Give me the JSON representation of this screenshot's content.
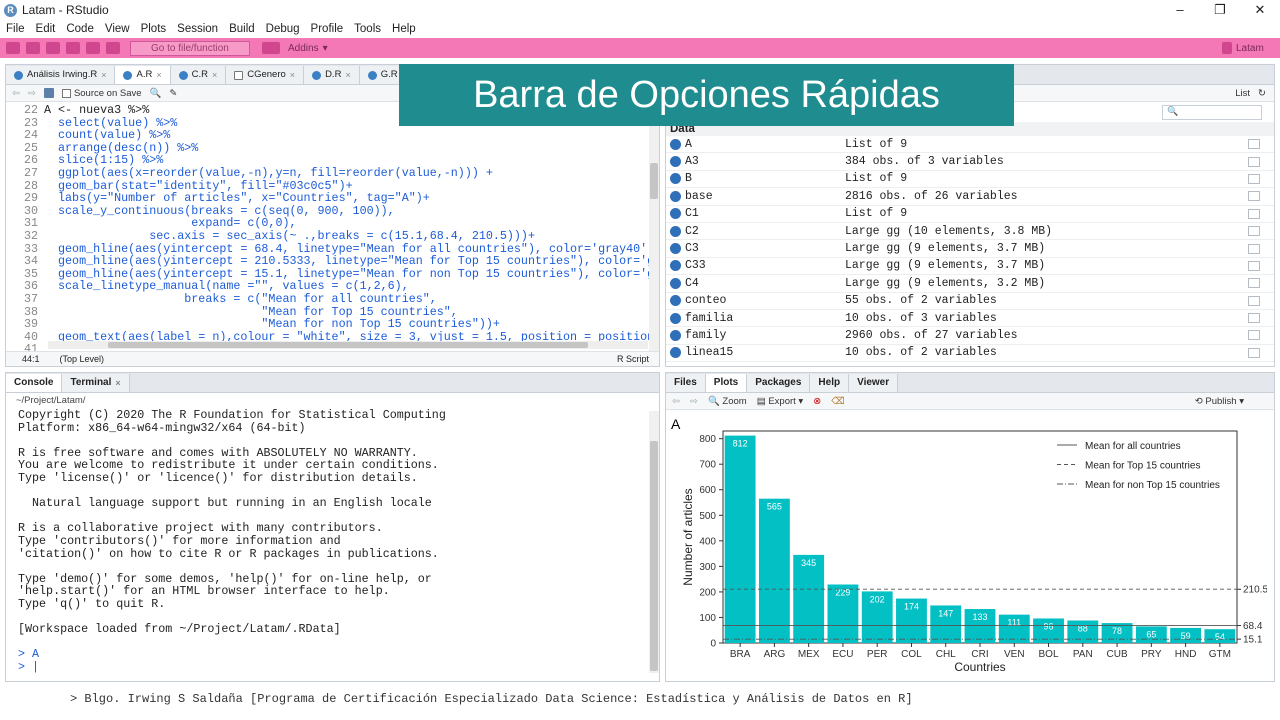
{
  "window": {
    "title": "Latam - RStudio"
  },
  "menu": [
    "File",
    "Edit",
    "Code",
    "View",
    "Plots",
    "Session",
    "Build",
    "Debug",
    "Profile",
    "Tools",
    "Help"
  ],
  "toolbar": {
    "goto_placeholder": "Go to file/function",
    "addins": "Addins",
    "project": "Latam"
  },
  "overlay_title": "Barra de Opciones Rápidas",
  "editor": {
    "tabs": [
      "Análisis Irwing.R",
      "A.R",
      "C.R",
      "CGenero",
      "D.R",
      "G.R"
    ],
    "source_on_save": "Source on Save",
    "status": {
      "pos": "44:1",
      "scope": "(Top Level)",
      "type": "R Script"
    },
    "lines": [
      {
        "n": "22",
        "t": "A <- nueva3 %>%"
      },
      {
        "n": "23",
        "t": "  select(value) %>%"
      },
      {
        "n": "24",
        "t": "  count(value) %>%"
      },
      {
        "n": "25",
        "t": "  arrange(desc(n)) %>%"
      },
      {
        "n": "26",
        "t": "  slice(1:15) %>%"
      },
      {
        "n": "27",
        "t": "  ggplot(aes(x=reorder(value,-n),y=n, fill=reorder(value,-n))) +"
      },
      {
        "n": "28",
        "t": "  geom_bar(stat=\"identity\", fill=\"#03c0c5\")+"
      },
      {
        "n": "29",
        "t": "  labs(y=\"Number of articles\", x=\"Countries\", tag=\"A\")+"
      },
      {
        "n": "30",
        "t": "  scale_y_continuous(breaks = c(seq(0, 900, 100)),"
      },
      {
        "n": "31",
        "t": "                     expand= c(0,0),"
      },
      {
        "n": "32",
        "t": "               sec.axis = sec_axis(~ .,breaks = c(15.1,68.4, 210.5)))+"
      },
      {
        "n": "33",
        "t": "  geom_hline(aes(yintercept = 68.4, linetype=\"Mean for all countries\"), color='gray40')+"
      },
      {
        "n": "34",
        "t": "  geom_hline(aes(yintercept = 210.5333, linetype=\"Mean for Top 15 countries\"), color='gr"
      },
      {
        "n": "35",
        "t": "  geom_hline(aes(yintercept = 15.1, linetype=\"Mean for non Top 15 countries\"), color='gr"
      },
      {
        "n": "36",
        "t": "  scale_linetype_manual(name =\"\", values = c(1,2,6),"
      },
      {
        "n": "37",
        "t": "                    breaks = c(\"Mean for all countries\","
      },
      {
        "n": "38",
        "t": "                               \"Mean for Top 15 countries\","
      },
      {
        "n": "39",
        "t": "                               \"Mean for non Top 15 countries\"))+"
      },
      {
        "n": "40",
        "t": "  geom_text(aes(label = n),colour = \"white\", size = 3, vjust = 1.5, position = position_"
      },
      {
        "n": "41",
        "t": ""
      }
    ]
  },
  "environment": {
    "list_label": "List",
    "section": "Data",
    "rows": [
      {
        "name": "A",
        "value": "List of  9"
      },
      {
        "name": "A3",
        "value": "384 obs. of 3 variables"
      },
      {
        "name": "B",
        "value": "List of  9"
      },
      {
        "name": "base",
        "value": "2816 obs. of 26 variables"
      },
      {
        "name": "C1",
        "value": "List of  9"
      },
      {
        "name": "C2",
        "value": "Large gg (10 elements,  3.8 MB)"
      },
      {
        "name": "C3",
        "value": "Large gg (9 elements,  3.7 MB)"
      },
      {
        "name": "C33",
        "value": "Large gg (9 elements,  3.7 MB)"
      },
      {
        "name": "C4",
        "value": "Large gg (9 elements,  3.2 MB)"
      },
      {
        "name": "conteo",
        "value": "55 obs. of 2 variables"
      },
      {
        "name": "familia",
        "value": "10 obs. of 3 variables"
      },
      {
        "name": "family",
        "value": "2960 obs. of 27 variables"
      },
      {
        "name": "linea15",
        "value": "10 obs. of 2 variables"
      }
    ]
  },
  "console": {
    "tabs": [
      "Console",
      "Terminal"
    ],
    "path": "~/Project/Latam/",
    "lines": [
      "Copyright (C) 2020 The R Foundation for Statistical Computing",
      "Platform: x86_64-w64-mingw32/x64 (64-bit)",
      "",
      "R is free software and comes with ABSOLUTELY NO WARRANTY.",
      "You are welcome to redistribute it under certain conditions.",
      "Type 'license()' or 'licence()' for distribution details.",
      "",
      "  Natural language support but running in an English locale",
      "",
      "R is a collaborative project with many contributors.",
      "Type 'contributors()' for more information and",
      "'citation()' on how to cite R or R packages in publications.",
      "",
      "Type 'demo()' for some demos, 'help()' for on-line help, or",
      "'help.start()' for an HTML browser interface to help.",
      "Type 'q()' to quit R.",
      "",
      "[Workspace loaded from ~/Project/Latam/.RData]",
      ""
    ],
    "cmd1": "> A",
    "cmd2": "> |"
  },
  "plots_pane": {
    "tabs": [
      "Files",
      "Plots",
      "Packages",
      "Help",
      "Viewer"
    ],
    "zoom": "Zoom",
    "export": "Export",
    "publish": "Publish"
  },
  "chart_data": {
    "type": "bar",
    "tag": "A",
    "categories": [
      "BRA",
      "ARG",
      "MEX",
      "ECU",
      "PER",
      "COL",
      "CHL",
      "CRI",
      "VEN",
      "BOL",
      "PAN",
      "CUB",
      "PRY",
      "HND",
      "GTM"
    ],
    "values": [
      812,
      565,
      345,
      229,
      202,
      174,
      147,
      133,
      111,
      96,
      88,
      78,
      65,
      59,
      54
    ],
    "xlabel": "Countries",
    "ylabel": "Number of articles",
    "ylim": [
      0,
      830
    ],
    "yticks": [
      0,
      100,
      200,
      300,
      400,
      500,
      600,
      700,
      800
    ],
    "sec_ticks": [
      "210.5",
      "68.4",
      "15.1"
    ],
    "hlines": [
      {
        "name": "Mean for all countries",
        "y": 68.4,
        "dash": "solid"
      },
      {
        "name": "Mean for Top 15 countries",
        "y": 210.5333,
        "dash": "dashed"
      },
      {
        "name": "Mean for non Top 15 countries",
        "y": 15.1,
        "dash": "dotdash"
      }
    ],
    "bar_color": "#03c0c5"
  },
  "footer": "> Blgo. Irwing S Saldaña [Programa de Certificación Especializado Data Science: Estadística y Análisis de Datos en R]"
}
